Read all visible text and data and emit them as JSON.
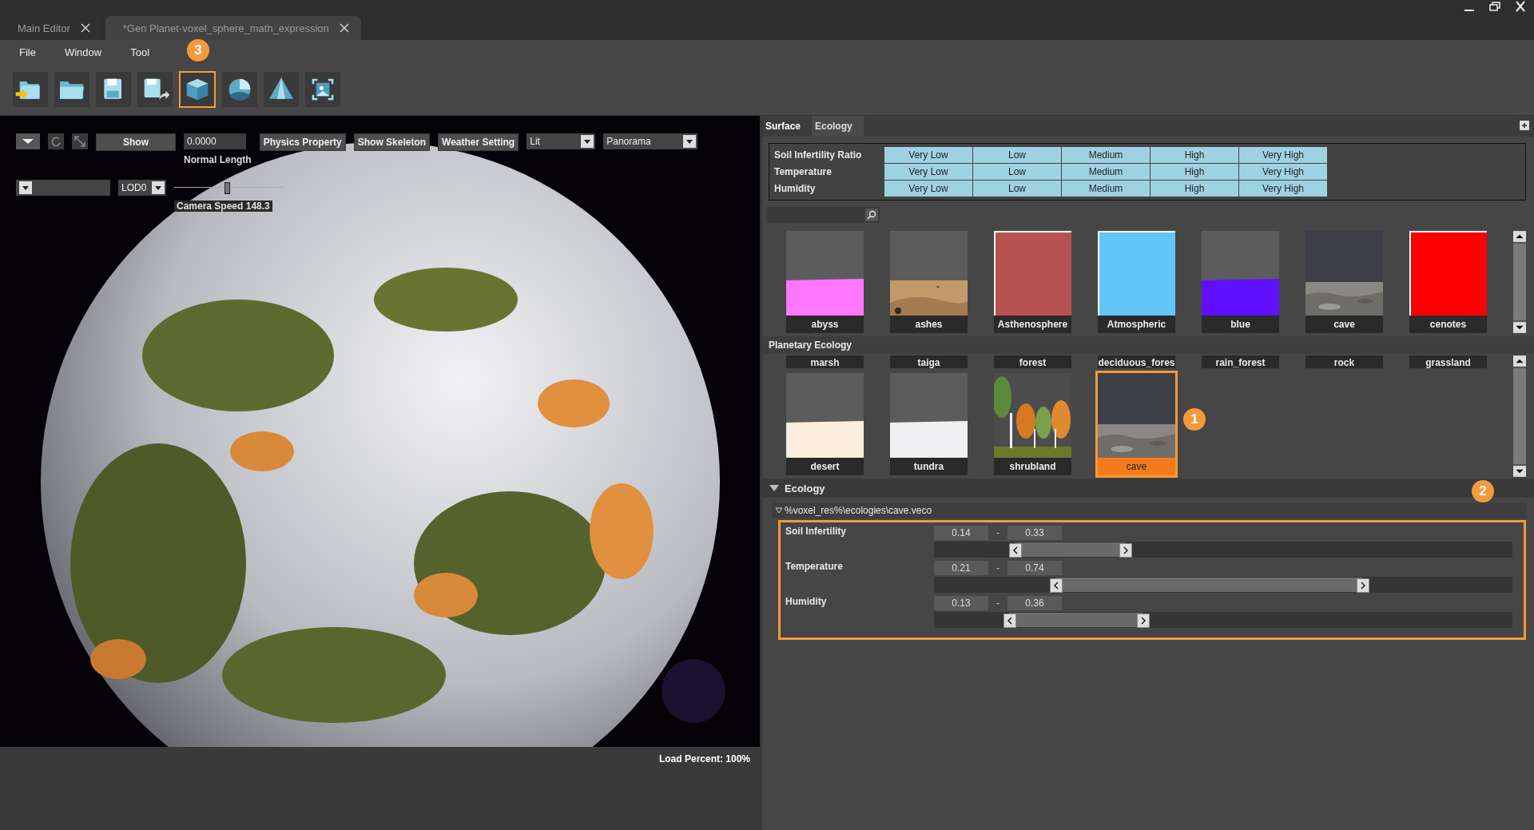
{
  "tabs": [
    {
      "label": "Main Editor",
      "selected": false
    },
    {
      "label": "*Gen Planet-voxel_sphere_math_expression",
      "selected": true
    }
  ],
  "menu": [
    "File",
    "Window",
    "Tool"
  ],
  "toolbar": [
    {
      "kind": "import",
      "highlighted": false
    },
    {
      "kind": "open",
      "highlighted": false
    },
    {
      "kind": "save",
      "highlighted": false
    },
    {
      "kind": "saveas",
      "highlighted": false
    },
    {
      "kind": "cube",
      "highlighted": true,
      "badge": "3"
    },
    {
      "kind": "sphere",
      "highlighted": false
    },
    {
      "kind": "terrain",
      "highlighted": false
    },
    {
      "kind": "frame",
      "highlighted": false
    }
  ],
  "viewport": {
    "show_button": "Show",
    "normal_length": {
      "value": "0.0000",
      "label": "Normal Length"
    },
    "buttons": [
      "Physics Property",
      "Show Skeleton",
      "Weather Setting"
    ],
    "shading": "Lit",
    "view": "Panorama",
    "lod": "LOD0",
    "camera_speed": {
      "level": 0.48,
      "label": "Camera Speed 148.3"
    },
    "load_percent": "Load Percent: 100%"
  },
  "panel_tabs": [
    {
      "label": "Surface",
      "selected": true
    },
    {
      "label": "Ecology",
      "selected": false
    }
  ],
  "ratio_table": [
    {
      "label": "Soil Infertility Ratio",
      "cells": [
        "Very Low",
        "Low",
        "Medium",
        "High",
        "Very High"
      ]
    },
    {
      "label": "Temperature",
      "cells": [
        "Very Low",
        "Low",
        "Medium",
        "High",
        "Very High"
      ]
    },
    {
      "label": "Humidity",
      "cells": [
        "Very Low",
        "Low",
        "Medium",
        "High",
        "Very High"
      ]
    }
  ],
  "surface_materials": [
    {
      "name": "abyss",
      "kind": "horizon",
      "color": "#ff77ff"
    },
    {
      "name": "ashes",
      "kind": "sand"
    },
    {
      "name": "Asthenosphere",
      "kind": "swatch",
      "color": "#b85252"
    },
    {
      "name": "Atmospheric",
      "kind": "swatch",
      "color": "#62c6f8"
    },
    {
      "name": "blue",
      "kind": "horizon",
      "color": "#6010ff"
    },
    {
      "name": "cave",
      "kind": "gravel"
    },
    {
      "name": "cenotes",
      "kind": "swatch",
      "color": "#ff0000"
    }
  ],
  "planetary_ecology": {
    "title": "Planetary Ecology",
    "partial_row": [
      "marsh",
      "taiga",
      "forest",
      "deciduous_fores",
      "rain_forest",
      "rock",
      "grassland"
    ],
    "items": [
      {
        "name": "desert",
        "kind": "horizon",
        "color": "#fbeedc",
        "selected": false
      },
      {
        "name": "tundra",
        "kind": "horizon",
        "color": "#f0f0f3",
        "selected": false
      },
      {
        "name": "shrubland",
        "kind": "trees",
        "selected": false
      },
      {
        "name": "cave",
        "kind": "gravel",
        "selected": true,
        "badge": "1"
      }
    ]
  },
  "ecology": {
    "header": "Ecology",
    "expanded": true,
    "file": "%voxel_res%\\ecologies\\cave.veco",
    "file_expanded": true,
    "badge": "2",
    "rows": [
      {
        "label": "Soil Infertility",
        "min": "0.14",
        "separator": "-",
        "max": "0.33",
        "thumbs": [
          {
            "level": 0.14
          },
          {
            "level": 0.33
          }
        ]
      },
      {
        "label": "Temperature",
        "min": "0.21",
        "separator": "-",
        "max": "0.74",
        "thumbs": [
          {
            "level": 0.21
          },
          {
            "level": 0.74
          }
        ]
      },
      {
        "label": "Humidity",
        "min": "0.13",
        "separator": "-",
        "max": "0.36",
        "thumbs": [
          {
            "level": 0.13
          },
          {
            "level": 0.36
          }
        ]
      }
    ]
  }
}
